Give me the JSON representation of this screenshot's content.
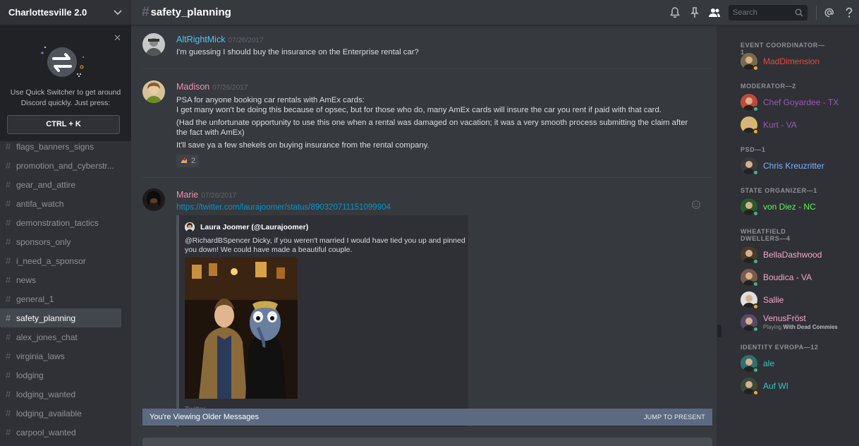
{
  "server": {
    "name": "Charlottesville 2.0"
  },
  "quick_switcher": {
    "text": "Use Quick Switcher to get around Discord quickly. Just press:",
    "shortcut": "CTRL + K"
  },
  "channels": [
    {
      "name": "flags_banners_signs",
      "active": false
    },
    {
      "name": "promotion_and_cyberstr...",
      "active": false
    },
    {
      "name": "gear_and_attire",
      "active": false
    },
    {
      "name": "antifa_watch",
      "active": false
    },
    {
      "name": "demonstration_tactics",
      "active": false
    },
    {
      "name": "sponsors_only",
      "active": false
    },
    {
      "name": "i_need_a_sponsor",
      "active": false
    },
    {
      "name": "news",
      "active": false
    },
    {
      "name": "general_1",
      "active": false
    },
    {
      "name": "safety_planning",
      "active": true
    },
    {
      "name": "alex_jones_chat",
      "active": false
    },
    {
      "name": "virginia_laws",
      "active": false
    },
    {
      "name": "lodging",
      "active": false
    },
    {
      "name": "lodging_wanted",
      "active": false
    },
    {
      "name": "lodging_available",
      "active": false
    },
    {
      "name": "carpool_wanted",
      "active": false
    }
  ],
  "header": {
    "hash": "#",
    "channel": "safety_planning",
    "search_placeholder": "Search"
  },
  "messages": [
    {
      "author": "AltRightMick",
      "color": "#4fc3f7",
      "timestamp": "07/26/2017",
      "lines": [
        "I'm guessing I should buy the insurance on the Enterprise rental car?"
      ]
    },
    {
      "author": "Madison",
      "color": "#f48fb1",
      "timestamp": "07/26/2017",
      "lines": [
        "PSA for anyone booking car rentals with AmEx cards:",
        "I get many won't be doing this because of opsec, but for those who do, many AmEx cards will insure the car you rent if paid with that card.",
        "(Had the unfortunate opportunity to use this one when a rental was damaged on vacation; it was a very smooth process submitting the claim after the fact with AmEx)",
        "It'll save ya a few shekels on buying insurance from the rental company."
      ],
      "reaction_count": "2"
    },
    {
      "author": "Marie",
      "color": "#f48fb1",
      "timestamp": "07/26/2017",
      "link": "https://twitter.com/laurajoomer/status/890320711151099904",
      "embed": {
        "author": "Laura Joomer (@Laurajoomer)",
        "description": "@RichardBSpencer Dicky, if you weren't married I would have tied you up and pinned you down! We could have made a beautiful couple.",
        "footer": "Twitter"
      }
    }
  ],
  "older_bar": {
    "left": "You're Viewing Older Messages",
    "right": "JUMP TO PRESENT"
  },
  "member_groups": [
    {
      "role": "EVENT COORDINATOR—1",
      "members": [
        {
          "name": "MadDimension",
          "color": "#e74c3c",
          "status": "idle"
        }
      ]
    },
    {
      "role": "MODERATOR—2",
      "members": [
        {
          "name": "Chef Goyardee - TX",
          "color": "#9b59b6",
          "status": "online"
        },
        {
          "name": "Kurt - VA",
          "color": "#9b59b6",
          "status": "idle"
        }
      ]
    },
    {
      "role": "PSD—1",
      "members": [
        {
          "name": "Chris Kreuzritter",
          "color": "#7ab3ff",
          "status": "online"
        }
      ]
    },
    {
      "role": "STATE ORGANIZER—1",
      "members": [
        {
          "name": "von Diez - NC",
          "color": "#5ef35e",
          "status": "online"
        }
      ]
    },
    {
      "role": "WHEATFIELD DWELLERS—4",
      "members": [
        {
          "name": "BellaDashwood",
          "color": "#f8a5cf",
          "status": "online"
        },
        {
          "name": "Boudica - VA",
          "color": "#f8a5cf",
          "status": "online"
        },
        {
          "name": "Sallie",
          "color": "#f8a5cf",
          "status": "idle"
        },
        {
          "name": "VenusFröst",
          "color": "#f8a5cf",
          "status": "online",
          "activity_prefix": "Playing",
          "activity": "With Dead Commies"
        }
      ]
    },
    {
      "role": "IDENTITY EVROPA—12",
      "members": [
        {
          "name": "ale",
          "color": "#36c4ca",
          "status": "online"
        },
        {
          "name": "Auf WI",
          "color": "#36c4ca",
          "status": "idle"
        }
      ]
    }
  ]
}
